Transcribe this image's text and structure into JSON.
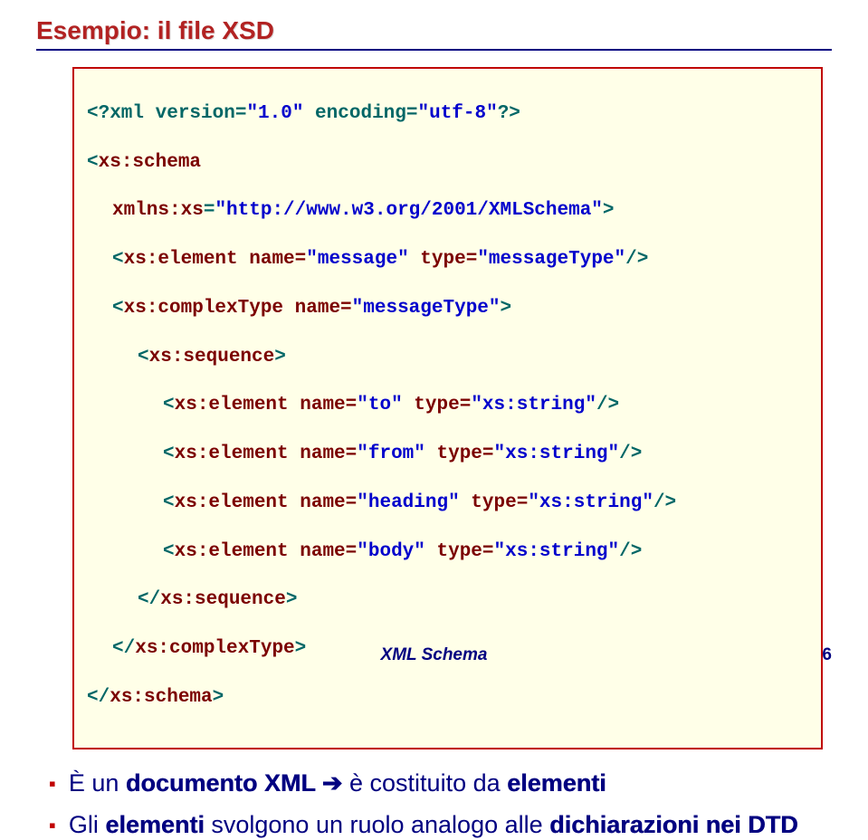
{
  "title": "Esempio: il file XSD",
  "code": {
    "l1a": "<?xml version=",
    "l1b": "\"1.0\"",
    "l1c": " encoding=",
    "l1d": "\"utf-8\"",
    "l1e": "?>",
    "l2a": "<",
    "l2b": "xs:schema",
    "l3a": "xmlns:xs",
    "l3b": "=",
    "l3c": "\"http://www.w3.org/2001/XMLSchema\"",
    "l3d": ">",
    "l4a": "<",
    "l4b": "xs:element",
    "l4c": " name=",
    "l4d": "\"message\"",
    "l4e": " type=",
    "l4f": "\"messageType\"",
    "l4g": "/>",
    "l5a": "<",
    "l5b": "xs:complexType",
    "l5c": " name=",
    "l5d": "\"messageType\"",
    "l5e": ">",
    "l6a": "<",
    "l6b": "xs:sequence",
    "l6c": ">",
    "l7a": "<",
    "l7b": "xs:element",
    "l7c": " name=",
    "l7d": "\"to\"",
    "l7e": " type=",
    "l7f": "\"xs:string\"",
    "l7g": "/>",
    "l8a": "<",
    "l8b": "xs:element",
    "l8c": " name=",
    "l8d": "\"from\"",
    "l8e": " type=",
    "l8f": "\"xs:string\"",
    "l8g": "/>",
    "l9a": "<",
    "l9b": "xs:element",
    "l9c": " name=",
    "l9d": "\"heading\"",
    "l9e": " type=",
    "l9f": "\"xs:string\"",
    "l9g": "/>",
    "l10a": "<",
    "l10b": "xs:element",
    "l10c": " name=",
    "l10d": "\"body\"",
    "l10e": " type=",
    "l10f": "\"xs:string\"",
    "l10g": "/>",
    "l11a": "</",
    "l11b": "xs:sequence",
    "l11c": ">",
    "l12a": "</",
    "l12b": "xs:complexType",
    "l12c": ">",
    "l13a": "</",
    "l13b": "xs:schema",
    "l13c": ">"
  },
  "bullets": {
    "b1a": "È un ",
    "b1b": "documento XML",
    "b1arrow": " ➔ ",
    "b1c": "è costituito da ",
    "b1d": "elementi",
    "b2a": "Gli ",
    "b2b": "elementi ",
    "b2c": " svolgono un ruolo analogo alle ",
    "b2d": "dichiarazioni nei DTD"
  },
  "footer": "XML Schema",
  "pagenum": "6"
}
